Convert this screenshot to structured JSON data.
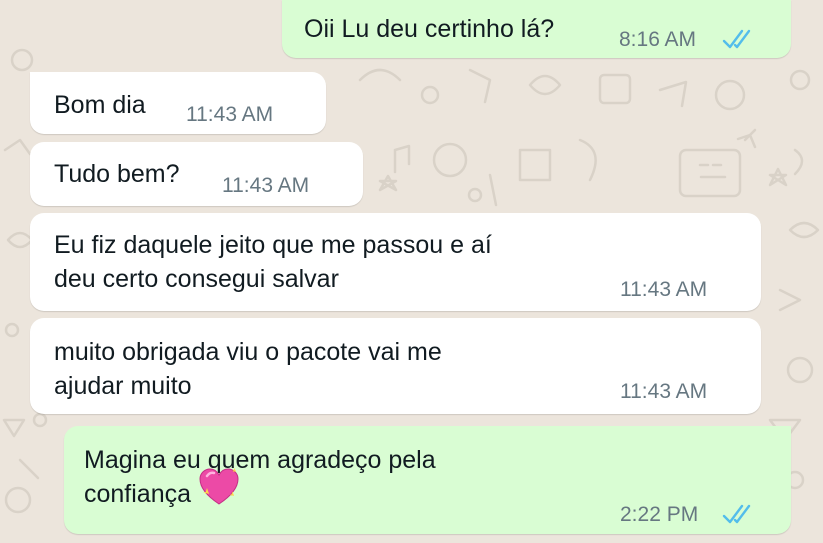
{
  "colors": {
    "wallpaper": "#ece5dc",
    "incoming_bubble": "#ffffff",
    "outgoing_bubble": "#d9fdd3",
    "timestamp": "#667781",
    "read_ticks": "#53bdeb"
  },
  "messages": [
    {
      "direction": "outgoing",
      "text": "Oii Lu deu certinho lá?",
      "time": "8:16 AM",
      "status": "read"
    },
    {
      "direction": "incoming",
      "text": "Bom dia",
      "time": "11:43 AM"
    },
    {
      "direction": "incoming",
      "text": "Tudo bem?",
      "time": "11:43 AM"
    },
    {
      "direction": "incoming",
      "text": "Eu fiz daquele jeito que me passou e aí\ndeu certo consegui salvar",
      "time": "11:43 AM"
    },
    {
      "direction": "incoming",
      "text": "muito obrigada viu o pacote vai me\najudar muito",
      "time": "11:43 AM"
    },
    {
      "direction": "outgoing",
      "text": "Magina eu quem agradeço pela\nconfiança",
      "emoji": "sparkling-heart",
      "time": "2:22 PM",
      "status": "read"
    }
  ]
}
